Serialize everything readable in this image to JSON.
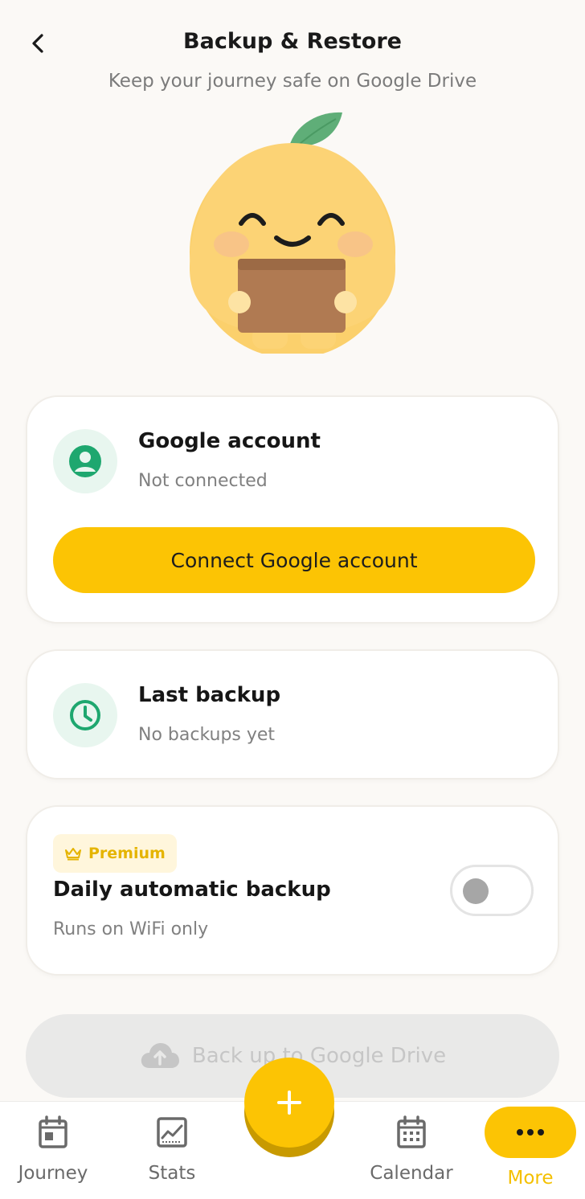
{
  "header": {
    "title": "Backup & Restore",
    "subtitle": "Keep your journey safe on Google Drive"
  },
  "google_account": {
    "title": "Google account",
    "status": "Not connected",
    "connect_label": "Connect Google account"
  },
  "last_backup": {
    "title": "Last backup",
    "status": "No backups yet"
  },
  "auto_backup": {
    "badge": "Premium",
    "title": "Daily automatic backup",
    "subtitle": "Runs on WiFi only",
    "enabled": false
  },
  "backup_button": {
    "label": "Back up to Google Drive",
    "enabled": false
  },
  "nav": {
    "items": [
      {
        "label": "Journey",
        "icon": "journey-icon"
      },
      {
        "label": "Stats",
        "icon": "stats-icon"
      },
      {
        "label": "Calendar",
        "icon": "calendar-icon"
      },
      {
        "label": "More",
        "icon": "more-icon",
        "active": true
      }
    ],
    "fab_icon": "plus-icon"
  },
  "colors": {
    "accent": "#fcc404",
    "icon_green": "#1ea76f",
    "icon_bg": "#e8f6ef",
    "background": "#fbf9f6"
  }
}
